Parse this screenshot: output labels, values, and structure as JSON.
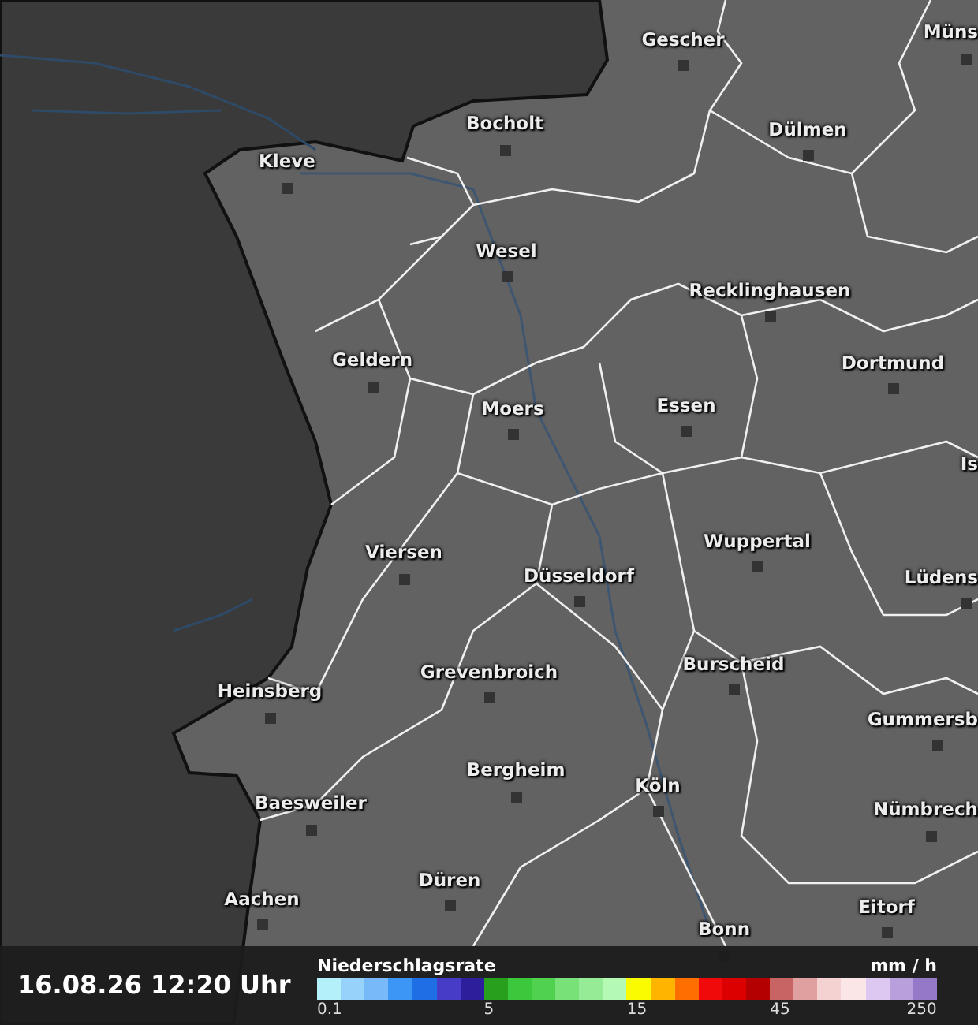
{
  "cities": [
    "Gescher",
    "Müns",
    "Bocholt",
    "Dülmen",
    "Kleve",
    "Wesel",
    "Recklinghausen",
    "Dortmund",
    "Geldern",
    "Moers",
    "Essen",
    "Is",
    "Wuppertal",
    "Viersen",
    "Düsseldorf",
    "Lüdens",
    "Heinsberg",
    "Grevenbroich",
    "Burscheid",
    "Gummersb",
    "Bergheim",
    "Köln",
    "Baesweiler",
    "Nümbrech",
    "Düren",
    "Eitorf",
    "Aachen",
    "Bonn"
  ],
  "timestamp": "16.08.26 12:20 Uhr",
  "legend": {
    "title": "Niederschlagsrate",
    "unit": "mm / h",
    "end_tick": "250",
    "cells": [
      {
        "color": "#b4f0fa",
        "tick": "0.1"
      },
      {
        "color": "#96d2fa"
      },
      {
        "color": "#78b9fa"
      },
      {
        "color": "#3c96f5"
      },
      {
        "color": "#1e6ee6"
      },
      {
        "color": "#463cc8"
      },
      {
        "color": "#2d1e9b"
      },
      {
        "color": "#28a01e",
        "tick": "5"
      },
      {
        "color": "#3cc83c"
      },
      {
        "color": "#50d250"
      },
      {
        "color": "#78e178"
      },
      {
        "color": "#96eb96"
      },
      {
        "color": "#b4fab4"
      },
      {
        "color": "#fafa00",
        "tick": "15"
      },
      {
        "color": "#ffb400"
      },
      {
        "color": "#ff6e00"
      },
      {
        "color": "#f00a0a"
      },
      {
        "color": "#dc0000"
      },
      {
        "color": "#b40000"
      },
      {
        "color": "#c86464",
        "tick": "45"
      },
      {
        "color": "#e1a0a0"
      },
      {
        "color": "#f5d2d2"
      },
      {
        "color": "#fae6e6"
      },
      {
        "color": "#dcc8f0"
      },
      {
        "color": "#b9a0dc"
      },
      {
        "color": "#9678c8"
      }
    ]
  }
}
